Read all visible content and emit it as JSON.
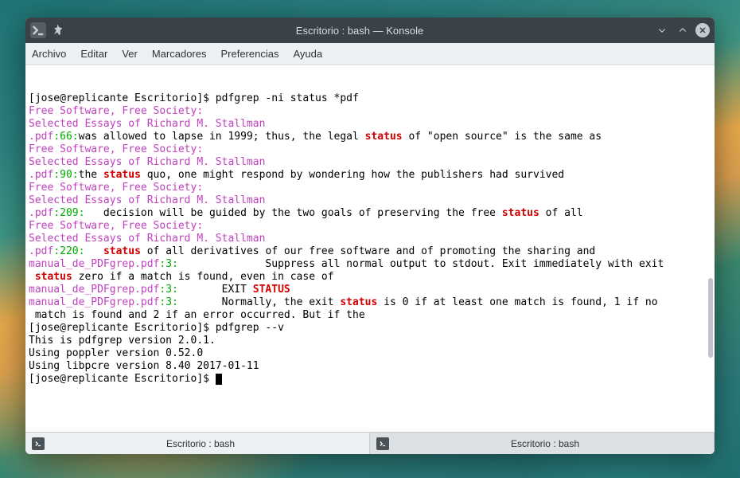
{
  "window": {
    "title": "Escritorio : bash — Konsole"
  },
  "menubar": {
    "items": [
      "Archivo",
      "Editar",
      "Ver",
      "Marcadores",
      "Preferencias",
      "Ayuda"
    ]
  },
  "terminal": {
    "lines": [
      {
        "segments": [
          {
            "t": "[jose@replicante Escritorio]$ pdfgrep -ni status *pdf"
          }
        ]
      },
      {
        "segments": [
          {
            "t": "Free Software, Free Society:",
            "c": "magenta"
          }
        ]
      },
      {
        "segments": [
          {
            "t": "Selected Essays of Richard M. Stallman",
            "c": "magenta"
          }
        ]
      },
      {
        "segments": [
          {
            "t": ".pdf",
            "c": "magenta"
          },
          {
            "t": ":",
            "c": "green"
          },
          {
            "t": "66",
            "c": "green"
          },
          {
            "t": ":",
            "c": "green"
          },
          {
            "t": "was allowed to lapse in 1999; thus, the legal "
          },
          {
            "t": "status",
            "c": "red"
          },
          {
            "t": " of \"open source\" is the same as"
          }
        ]
      },
      {
        "segments": [
          {
            "t": "Free Software, Free Society:",
            "c": "magenta"
          }
        ]
      },
      {
        "segments": [
          {
            "t": "Selected Essays of Richard M. Stallman",
            "c": "magenta"
          }
        ]
      },
      {
        "segments": [
          {
            "t": ".pdf",
            "c": "magenta"
          },
          {
            "t": ":",
            "c": "green"
          },
          {
            "t": "90",
            "c": "green"
          },
          {
            "t": ":",
            "c": "green"
          },
          {
            "t": "the "
          },
          {
            "t": "status",
            "c": "red"
          },
          {
            "t": " quo, one might respond by wondering how the publishers had survived"
          }
        ]
      },
      {
        "segments": [
          {
            "t": "Free Software, Free Society:",
            "c": "magenta"
          }
        ]
      },
      {
        "segments": [
          {
            "t": "Selected Essays of Richard M. Stallman",
            "c": "magenta"
          }
        ]
      },
      {
        "segments": [
          {
            "t": ".pdf",
            "c": "magenta"
          },
          {
            "t": ":",
            "c": "green"
          },
          {
            "t": "209",
            "c": "green"
          },
          {
            "t": ":",
            "c": "green"
          },
          {
            "t": "   decision will be guided by the two goals of preserving the free "
          },
          {
            "t": "status",
            "c": "red"
          },
          {
            "t": " of all"
          }
        ]
      },
      {
        "segments": [
          {
            "t": "Free Software, Free Society:",
            "c": "magenta"
          }
        ]
      },
      {
        "segments": [
          {
            "t": "Selected Essays of Richard M. Stallman",
            "c": "magenta"
          }
        ]
      },
      {
        "segments": [
          {
            "t": ".pdf",
            "c": "magenta"
          },
          {
            "t": ":",
            "c": "green"
          },
          {
            "t": "220",
            "c": "green"
          },
          {
            "t": ":",
            "c": "green"
          },
          {
            "t": "   "
          },
          {
            "t": "status",
            "c": "red"
          },
          {
            "t": " of all derivatives of our free software and of promoting the sharing and"
          }
        ]
      },
      {
        "segments": [
          {
            "t": "manual_de_PDFgrep.pdf",
            "c": "magenta"
          },
          {
            "t": ":",
            "c": "green"
          },
          {
            "t": "3",
            "c": "green"
          },
          {
            "t": ":",
            "c": "green"
          },
          {
            "t": "              Suppress all normal output to stdout. Exit immediately with exit"
          }
        ]
      },
      {
        "segments": [
          {
            "t": " "
          },
          {
            "t": "status",
            "c": "red"
          },
          {
            "t": " zero if a match is found, even in case of"
          }
        ]
      },
      {
        "segments": [
          {
            "t": "manual_de_PDFgrep.pdf",
            "c": "magenta"
          },
          {
            "t": ":",
            "c": "green"
          },
          {
            "t": "3",
            "c": "green"
          },
          {
            "t": ":",
            "c": "green"
          },
          {
            "t": "       EXIT "
          },
          {
            "t": "STATUS",
            "c": "red"
          }
        ]
      },
      {
        "segments": [
          {
            "t": "manual_de_PDFgrep.pdf",
            "c": "magenta"
          },
          {
            "t": ":",
            "c": "green"
          },
          {
            "t": "3",
            "c": "green"
          },
          {
            "t": ":",
            "c": "green"
          },
          {
            "t": "       Normally, the exit "
          },
          {
            "t": "status",
            "c": "red"
          },
          {
            "t": " is 0 if at least one match is found, 1 if no"
          }
        ]
      },
      {
        "segments": [
          {
            "t": " match is found and 2 if an error occurred. But if the"
          }
        ]
      },
      {
        "segments": [
          {
            "t": "[jose@replicante Escritorio]$ pdfgrep --v"
          }
        ]
      },
      {
        "segments": [
          {
            "t": "This is pdfgrep version 2.0.1."
          }
        ]
      },
      {
        "segments": [
          {
            "t": ""
          }
        ]
      },
      {
        "segments": [
          {
            "t": "Using poppler version 0.52.0"
          }
        ]
      },
      {
        "segments": [
          {
            "t": "Using libpcre version 8.40 2017-01-11"
          }
        ]
      },
      {
        "segments": [
          {
            "t": "[jose@replicante Escritorio]$ "
          }
        ],
        "cursor": true
      }
    ]
  },
  "tabs": [
    {
      "label": "Escritorio : bash",
      "active": true
    },
    {
      "label": "Escritorio : bash",
      "active": false
    }
  ]
}
